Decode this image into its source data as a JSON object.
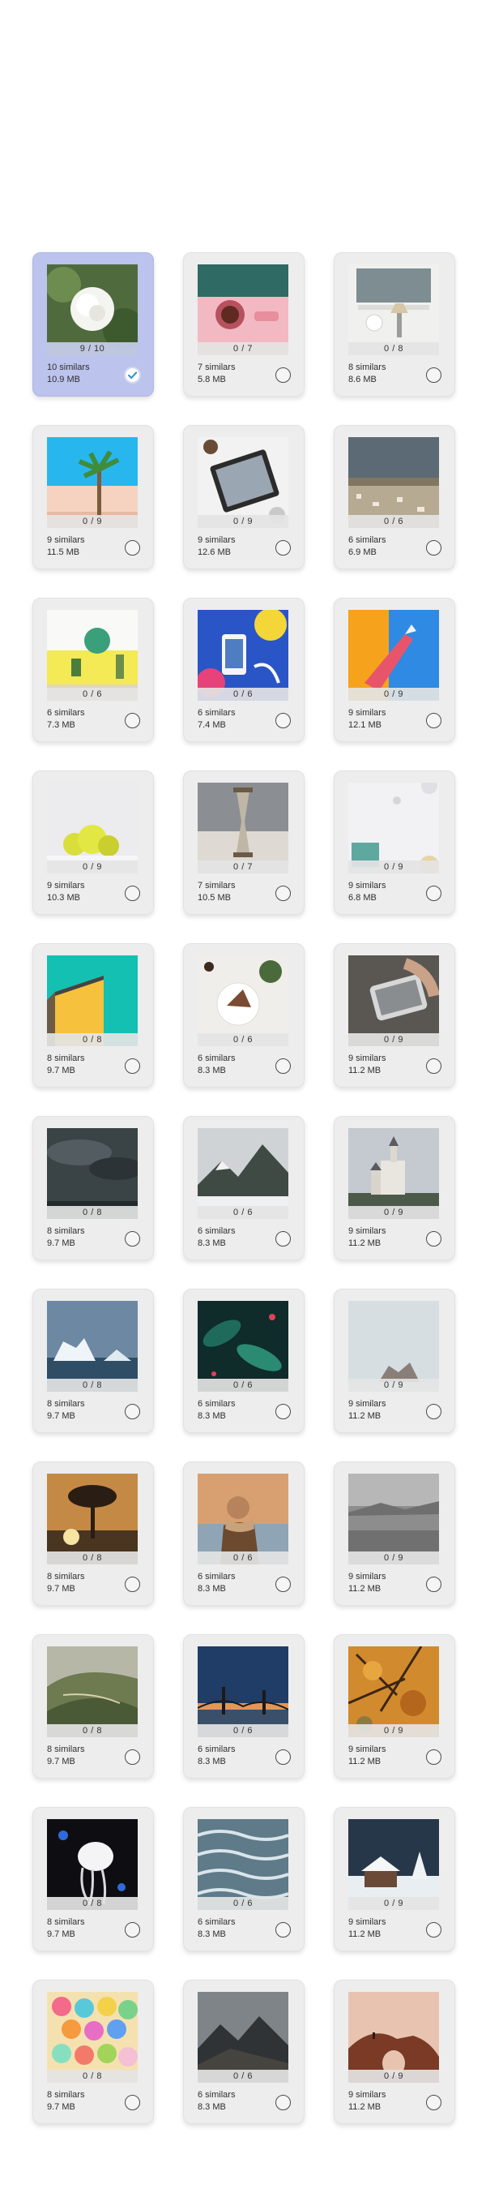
{
  "groups": [
    {
      "count": "9 / 10",
      "similars": "10 similars",
      "size": "10.9 MB",
      "selected": true,
      "image": "white-camellia-flower"
    },
    {
      "count": "0 / 7",
      "similars": "7 similars",
      "size": "5.8 MB",
      "selected": false,
      "image": "pink-coffee-table"
    },
    {
      "count": "0 / 8",
      "similars": "8 similars",
      "size": "8.6 MB",
      "selected": false,
      "image": "white-desk-lamp"
    },
    {
      "count": "0 / 9",
      "similars": "9 similars",
      "size": "11.5 MB",
      "selected": false,
      "image": "palm-tree-blue-sky"
    },
    {
      "count": "0 / 9",
      "similars": "9 similars",
      "size": "12.6 MB",
      "selected": false,
      "image": "tablet-on-desk"
    },
    {
      "count": "0 / 6",
      "similars": "6 similars",
      "size": "6.9 MB",
      "selected": false,
      "image": "city-panorama"
    },
    {
      "count": "0 / 6",
      "similars": "6 similars",
      "size": "7.3 MB",
      "selected": false,
      "image": "yellow-wall-plants"
    },
    {
      "count": "0 / 6",
      "similars": "6 similars",
      "size": "7.4 MB",
      "selected": false,
      "image": "colorful-phone-hand"
    },
    {
      "count": "0 / 9",
      "similars": "9 similars",
      "size": "12.1 MB",
      "selected": false,
      "image": "pink-hand-orange"
    },
    {
      "count": "0 / 9",
      "similars": "9 similars",
      "size": "10.3 MB",
      "selected": false,
      "image": "yellow-cactus"
    },
    {
      "count": "0 / 7",
      "similars": "7 similars",
      "size": "10.5 MB",
      "selected": false,
      "image": "hourglass"
    },
    {
      "count": "0 / 9",
      "similars": "9 similars",
      "size": "6.8 MB",
      "selected": false,
      "image": "white-flatlay"
    },
    {
      "count": "0 / 8",
      "similars": "8 similars",
      "size": "9.7 MB",
      "selected": false,
      "image": "yellow-building-teal"
    },
    {
      "count": "0 / 6",
      "similars": "6 similars",
      "size": "8.3 MB",
      "selected": false,
      "image": "coffee-flatlay"
    },
    {
      "count": "0 / 9",
      "similars": "9 similars",
      "size": "11.2 MB",
      "selected": false,
      "image": "hand-smartphone"
    },
    {
      "count": "0 / 8",
      "similars": "8 similars",
      "size": "9.7 MB",
      "selected": false,
      "image": "storm-clouds"
    },
    {
      "count": "0 / 6",
      "similars": "6 similars",
      "size": "8.3 MB",
      "selected": false,
      "image": "mountain-lake"
    },
    {
      "count": "0 / 9",
      "similars": "9 similars",
      "size": "11.2 MB",
      "selected": false,
      "image": "castle"
    },
    {
      "count": "0 / 8",
      "similars": "8 similars",
      "size": "9.7 MB",
      "selected": false,
      "image": "iceberg"
    },
    {
      "count": "0 / 6",
      "similars": "6 similars",
      "size": "8.3 MB",
      "selected": false,
      "image": "dark-leaves"
    },
    {
      "count": "0 / 9",
      "similars": "9 similars",
      "size": "11.2 MB",
      "selected": false,
      "image": "misty-rock"
    },
    {
      "count": "0 / 8",
      "similars": "8 similars",
      "size": "9.7 MB",
      "selected": false,
      "image": "sunset-tree"
    },
    {
      "count": "0 / 6",
      "similars": "6 similars",
      "size": "8.3 MB",
      "selected": false,
      "image": "person-scarf"
    },
    {
      "count": "0 / 9",
      "similars": "9 similars",
      "size": "11.2 MB",
      "selected": false,
      "image": "foggy-sea"
    },
    {
      "count": "0 / 8",
      "similars": "8 similars",
      "size": "9.7 MB",
      "selected": false,
      "image": "green-hills"
    },
    {
      "count": "0 / 6",
      "similars": "6 similars",
      "size": "8.3 MB",
      "selected": false,
      "image": "bridge-dusk"
    },
    {
      "count": "0 / 9",
      "similars": "9 similars",
      "size": "11.2 MB",
      "selected": false,
      "image": "autumn-branches"
    },
    {
      "count": "0 / 8",
      "similars": "8 similars",
      "size": "9.7 MB",
      "selected": false,
      "image": "jellyfish"
    },
    {
      "count": "0 / 6",
      "similars": "6 similars",
      "size": "8.3 MB",
      "selected": false,
      "image": "water-ripples"
    },
    {
      "count": "0 / 9",
      "similars": "9 similars",
      "size": "11.2 MB",
      "selected": false,
      "image": "snowy-cabin"
    },
    {
      "count": "0 / 8",
      "similars": "8 similars",
      "size": "9.7 MB",
      "selected": false,
      "image": "colorful-eggs"
    },
    {
      "count": "0 / 6",
      "similars": "6 similars",
      "size": "8.3 MB",
      "selected": false,
      "image": "dark-mountains"
    },
    {
      "count": "0 / 9",
      "similars": "9 similars",
      "size": "11.2 MB",
      "selected": false,
      "image": "rock-arch"
    }
  ]
}
